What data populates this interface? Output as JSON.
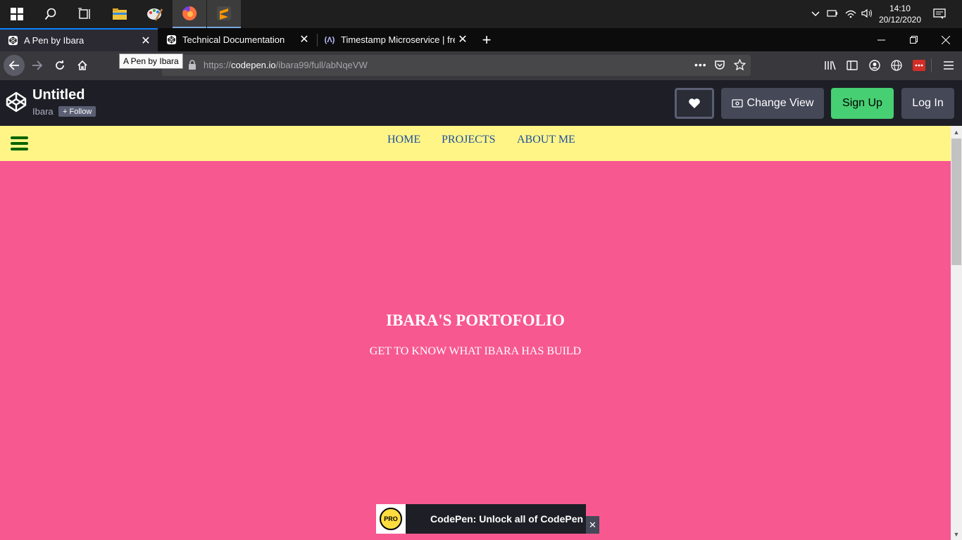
{
  "taskbar": {
    "icons": [
      "windows-start-icon",
      "search-icon",
      "task-view-icon",
      "file-explorer-icon",
      "paint-icon",
      "firefox-icon",
      "sublime-text-icon"
    ],
    "clock_time": "14:10",
    "clock_date": "20/12/2020"
  },
  "browser": {
    "tabs": [
      {
        "label": "A Pen by Ibara"
      },
      {
        "label": "Technical Documentation"
      },
      {
        "label": "Timestamp Microservice | freeCodeCamp"
      }
    ],
    "tooltip": "A Pen by Ibara",
    "url_scheme": "https://",
    "url_host": "codepen.io",
    "url_path": "/ibara99/full/abNqeVW"
  },
  "codepen": {
    "title": "Untitled",
    "user": "Ibara",
    "follow_label": "+ Follow",
    "change_view_label": "Change View",
    "signup_label": "Sign Up",
    "login_label": "Log In"
  },
  "site": {
    "nav_links": [
      "HOME",
      "PROJECTS",
      "ABOUT ME"
    ],
    "hero_title": "IBARA'S PORTOFOLIO",
    "hero_subtitle": "GET TO KNOW WHAT IBARA HAS BUILD",
    "background_color": "#f75890",
    "nav_color": "#fff587"
  },
  "promo": {
    "badge": "PRO",
    "text": "CodePen: Unlock all of CodePen"
  }
}
